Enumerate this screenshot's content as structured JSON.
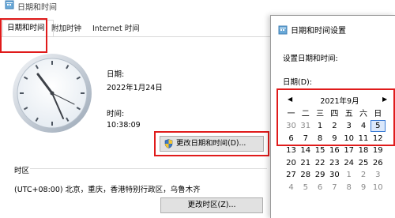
{
  "main_window": {
    "title": "日期和时间",
    "tabs": [
      "日期和时间",
      "附加时钟",
      "Internet 时间"
    ],
    "date_label": "日期:",
    "date_value": "2022年1月24日",
    "time_label": "时间:",
    "time_value": "10:38:09",
    "change_datetime_button": "更改日期和时间(D)...",
    "timezone_section": "时区",
    "timezone_value": "(UTC+08:00) 北京，重庆，香港特别行政区，乌鲁木齐",
    "change_timezone_button": "更改时区(Z)..."
  },
  "settings_window": {
    "title": "日期和时间设置",
    "set_label": "设置日期和时间:",
    "date_label": "日期(D):",
    "calendar": {
      "month": "2021年9月",
      "prev": "◀",
      "next": "▶",
      "weekdays": [
        "一",
        "二",
        "三",
        "四",
        "五",
        "六",
        "日"
      ],
      "weeks": [
        [
          "30",
          "31",
          "1",
          "2",
          "3",
          "4",
          "5"
        ],
        [
          "6",
          "7",
          "8",
          "9",
          "10",
          "11",
          "12"
        ],
        [
          "13",
          "14",
          "15",
          "16",
          "17",
          "18",
          "19"
        ],
        [
          "20",
          "21",
          "22",
          "23",
          "24",
          "25",
          "26"
        ],
        [
          "27",
          "28",
          "29",
          "30",
          "1",
          "2",
          "3"
        ],
        [
          "4",
          "5",
          "6",
          "7",
          "8",
          "9",
          "10"
        ]
      ],
      "selected_day": "5"
    }
  },
  "colors": {
    "highlight": "#e01b1b",
    "selected": "#3a7bd5"
  },
  "icons": [
    "clock-icon",
    "shield-icon",
    "datetime-app-icon"
  ]
}
